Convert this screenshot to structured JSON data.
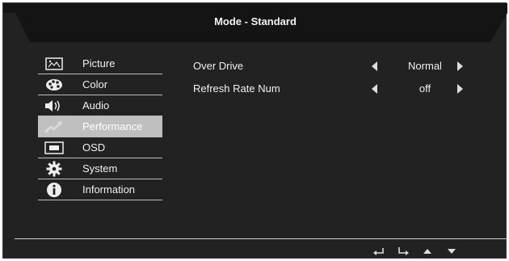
{
  "title": "Mode - Standard",
  "menu": [
    {
      "label": "Picture",
      "icon": "picture-icon"
    },
    {
      "label": "Color",
      "icon": "palette-icon"
    },
    {
      "label": "Audio",
      "icon": "speaker-icon"
    },
    {
      "label": "Performance",
      "icon": "performance-icon",
      "active": true
    },
    {
      "label": "OSD",
      "icon": "osd-icon"
    },
    {
      "label": "System",
      "icon": "gear-icon"
    },
    {
      "label": "Information",
      "icon": "info-icon"
    }
  ],
  "settings": [
    {
      "name": "Over Drive",
      "value": "Normal"
    },
    {
      "name": "Refresh Rate Num",
      "value": "off"
    }
  ],
  "footer_keys": [
    "back-icon",
    "enter-icon",
    "up-icon",
    "down-icon"
  ],
  "colors": {
    "panel": "#222222",
    "header": "#141414",
    "highlight": "#bfbfbf"
  }
}
